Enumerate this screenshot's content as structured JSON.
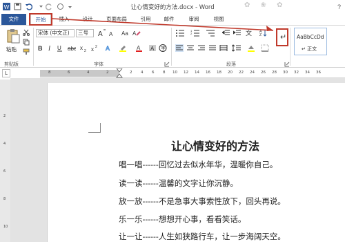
{
  "window": {
    "title": "让心情变好的方法.docx - Word",
    "decoration": "✿ ❀ ✿"
  },
  "tabs": [
    {
      "label": "文件"
    },
    {
      "label": "开始"
    },
    {
      "label": "插入"
    },
    {
      "label": "设计"
    },
    {
      "label": "页面布局"
    },
    {
      "label": "引用"
    },
    {
      "label": "邮件"
    },
    {
      "label": "审阅"
    },
    {
      "label": "视图"
    }
  ],
  "ribbon": {
    "paste_label": "粘贴",
    "font_name": "宋体 (中文正)",
    "font_size": "三号",
    "group_clipboard": "剪贴板",
    "group_font": "字体",
    "group_paragraph": "段落",
    "style_preview": "AaBbCcDd",
    "style_name": "↵ 正文"
  },
  "ruler": {
    "left": [
      "8",
      "6",
      "4",
      "2"
    ],
    "right": [
      "2",
      "4",
      "6",
      "8",
      "10",
      "12",
      "14",
      "16",
      "18",
      "20",
      "22",
      "24",
      "26",
      "28",
      "30",
      "32",
      "34",
      "36"
    ]
  },
  "vruler": [
    "2",
    "4",
    "6",
    "8",
    "10"
  ],
  "document": {
    "title": "让心情变好的方法",
    "lines": [
      "唱一唱------回忆过去似水年华，温暖你自己。",
      "读一读------温馨的文字让你沉静。",
      "放一放------不是急事大事索性放下，回头再说。",
      "乐一乐------想想开心事，看看笑话。",
      "让一让------人生如狭路行车，让一步海阔天空。"
    ]
  },
  "colors": {
    "accent": "#2b579a",
    "highlight": "#c0392b"
  }
}
